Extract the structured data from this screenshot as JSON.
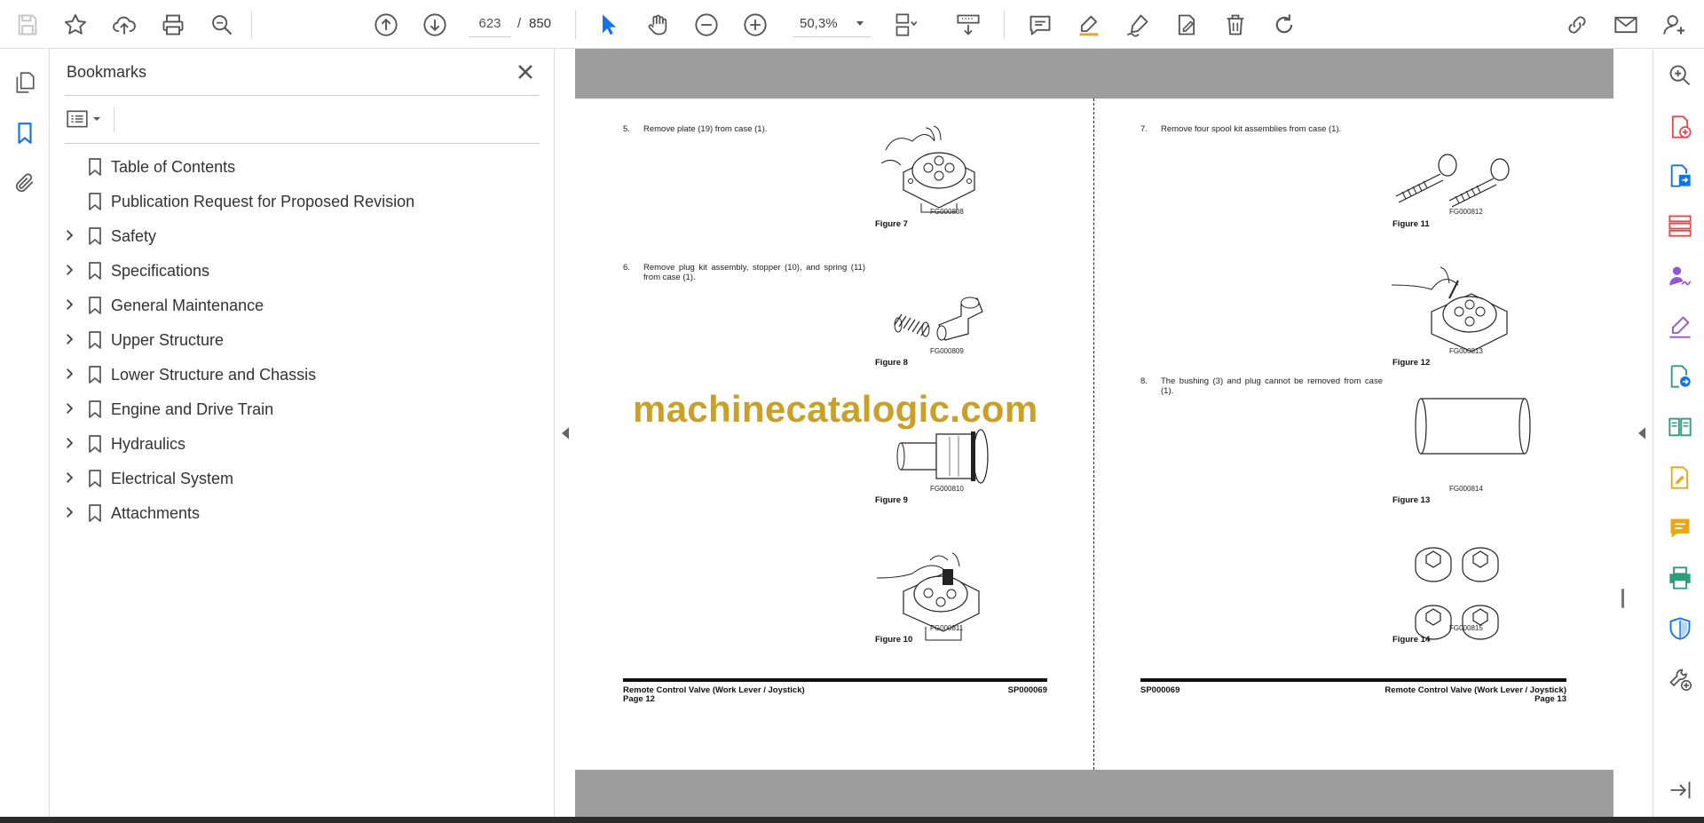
{
  "toolbar": {
    "current_page": "623",
    "page_separator": "/",
    "total_pages": "850",
    "zoom": "50,3%"
  },
  "bookmarks": {
    "title": "Bookmarks",
    "items": [
      {
        "label": "Table of Contents",
        "expandable": false
      },
      {
        "label": "Publication Request for Proposed Revision",
        "expandable": false
      },
      {
        "label": "Safety",
        "expandable": true
      },
      {
        "label": "Specifications",
        "expandable": true
      },
      {
        "label": "General Maintenance",
        "expandable": true
      },
      {
        "label": "Upper Structure",
        "expandable": true
      },
      {
        "label": "Lower Structure and Chassis",
        "expandable": true
      },
      {
        "label": "Engine and Drive Train",
        "expandable": true
      },
      {
        "label": "Hydraulics",
        "expandable": true
      },
      {
        "label": "Electrical System",
        "expandable": true
      },
      {
        "label": "Attachments",
        "expandable": true
      }
    ]
  },
  "document": {
    "watermark": "machinecatalogic.com",
    "left_page": {
      "steps": [
        {
          "num": "5.",
          "text": "Remove plate (19) from case (1)."
        },
        {
          "num": "6.",
          "text": "Remove plug kit assembly, stopper (10), and spring (11) from case (1)."
        }
      ],
      "figures": [
        {
          "caption": "Figure 7",
          "code": "FG000808"
        },
        {
          "caption": "Figure 8",
          "code": "FG000809"
        },
        {
          "caption": "Figure 9",
          "code": "FG000810"
        },
        {
          "caption": "Figure 10",
          "code": "FG000811"
        }
      ],
      "footer": {
        "title": "Remote Control Valve (Work Lever / Joystick)",
        "page": "Page 12",
        "code": "SP000069"
      }
    },
    "right_page": {
      "steps": [
        {
          "num": "7.",
          "text": "Remove four spool kit assemblies from case (1)."
        },
        {
          "num": "8.",
          "text": "The bushing (3) and plug cannot be removed from case (1)."
        }
      ],
      "figures": [
        {
          "caption": "Figure 11",
          "code": "FG000812"
        },
        {
          "caption": "Figure 12",
          "code": "FG000813"
        },
        {
          "caption": "Figure 13",
          "code": "FG000814"
        },
        {
          "caption": "Figure 14",
          "code": "FG000815"
        }
      ],
      "footer": {
        "code": "SP000069",
        "title": "Remote Control Valve (Work Lever / Joystick)",
        "page": "Page 13"
      }
    }
  },
  "icons": {
    "toolbar": [
      "save-icon",
      "bookmark-star-icon",
      "upload-cloud-icon",
      "print-icon",
      "find-icon",
      "previous-page-icon",
      "next-page-icon",
      "zoom-out-icon",
      "zoom-in-icon",
      "select-cursor-icon",
      "hand-icon",
      "page-fit-icon",
      "scroll-mode-icon",
      "comment-icon",
      "highlight-icon",
      "draw-icon",
      "fill-sign-icon",
      "delete-icon",
      "rotate-icon",
      "share-link-icon",
      "email-icon",
      "account-icon"
    ],
    "accent_blue": "#1473e6",
    "accent_red": "#e34850",
    "accent_purple": "#9256d9",
    "accent_green": "#2d9d78",
    "accent_yellow": "#e8a717"
  }
}
